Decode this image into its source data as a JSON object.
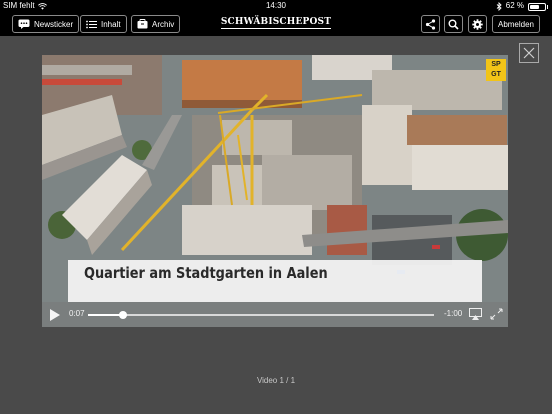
{
  "status_bar": {
    "carrier": "SIM fehlt",
    "time": "14:30",
    "battery_percent": "62 %",
    "battery_level": 0.62
  },
  "toolbar": {
    "newsticker_label": "Newsticker",
    "inhalt_label": "Inhalt",
    "archiv_label": "Archiv",
    "brand": "SCHWÄBISCHEPOST",
    "logout_label": "Abmelden"
  },
  "video": {
    "caption": "Quartier am Stadtgarten in Aalen",
    "logo_line1": "SP",
    "logo_line2": "GT",
    "elapsed": "0:07",
    "remaining": "-1:00",
    "progress": 0.1
  },
  "pager": {
    "label": "Video 1 / 1"
  }
}
